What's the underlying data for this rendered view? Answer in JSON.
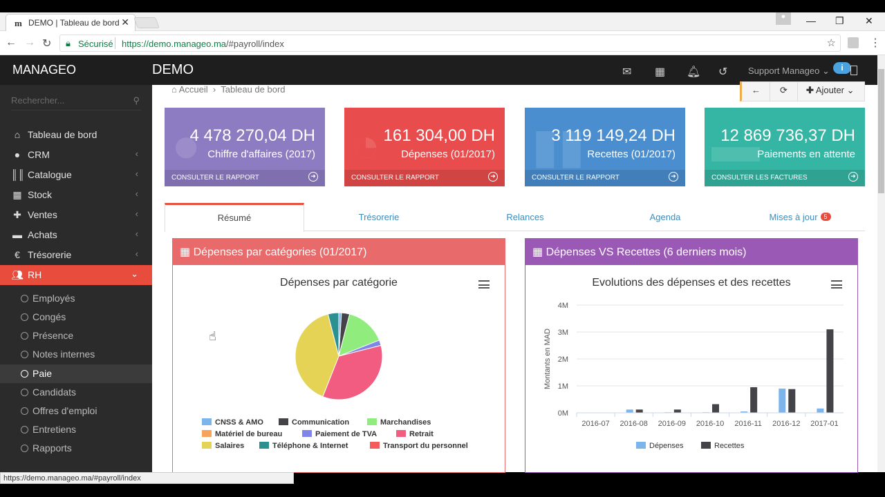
{
  "browser": {
    "tab_title": "DEMO | Tableau de bord",
    "tab_favicon": "m",
    "secure_label": "Sécurisé",
    "url_host": "https://demo.manageo.ma",
    "url_path": "/#payroll/index",
    "status_url": "https://demo.manageo.ma/#payroll/index"
  },
  "sidebar": {
    "brand": "MANAGEO",
    "search_placeholder": "Rechercher...",
    "items": [
      {
        "label": "Tableau de bord",
        "icon": "home-icon"
      },
      {
        "label": "CRM",
        "icon": "globe-icon"
      },
      {
        "label": "Catalogue",
        "icon": "barcode-icon"
      },
      {
        "label": "Stock",
        "icon": "grid-icon"
      },
      {
        "label": "Ventes",
        "icon": "plus-icon"
      },
      {
        "label": "Achats",
        "icon": "minus-icon"
      },
      {
        "label": "Trésorerie",
        "icon": "euro-icon"
      },
      {
        "label": "RH",
        "icon": "users-icon"
      }
    ],
    "rh_sub": [
      "Employés",
      "Congés",
      "Présence",
      "Notes internes",
      "Paie",
      "Candidats",
      "Offres d'emploi",
      "Entretiens",
      "Rapports"
    ]
  },
  "topnav": {
    "title": "DEMO",
    "user": "Support Manageo",
    "info_badge": "i"
  },
  "breadcrumb": {
    "home": "Accueil",
    "current": "Tableau de bord"
  },
  "actions": {
    "back": "←",
    "refresh": "⟳",
    "add": "Ajouter"
  },
  "cards": [
    {
      "value": "4 478 270,04 DH",
      "label": "Chiffre d'affaires (2017)",
      "link": "CONSULTER LE RAPPORT",
      "color": "#8e7cc3"
    },
    {
      "value": "161 304,00 DH",
      "label": "Dépenses (01/2017)",
      "link": "CONSULTER LE RAPPORT",
      "color": "#e84c4c"
    },
    {
      "value": "3 119 149,24 DH",
      "label": "Recettes (01/2017)",
      "link": "CONSULTER LE RAPPORT",
      "color": "#4a8ed0"
    },
    {
      "value": "12 869 736,37 DH",
      "label": "Paiements en attente",
      "link": "CONSULTER LES FACTURES",
      "color": "#35b5a3"
    }
  ],
  "tabs": [
    {
      "label": "Résumé"
    },
    {
      "label": "Trésorerie"
    },
    {
      "label": "Relances"
    },
    {
      "label": "Agenda"
    },
    {
      "label": "Mises à jour",
      "badge": "5"
    }
  ],
  "panel_left": {
    "header": "Dépenses par catégories (01/2017)",
    "color": "#e86a6a"
  },
  "panel_right": {
    "header": "Dépenses VS Recettes (6 derniers mois)",
    "color": "#9b59b6"
  },
  "chart_data": [
    {
      "type": "pie",
      "title": "Dépenses par catégorie",
      "legend_placement": "bottom",
      "slices": [
        {
          "name": "CNSS & AMO",
          "value": 1,
          "color": "#7cb5ec"
        },
        {
          "name": "Communication",
          "value": 3,
          "color": "#434348"
        },
        {
          "name": "Marchandises",
          "value": 15,
          "color": "#90ed7d"
        },
        {
          "name": "Matériel de bureau",
          "value": 0,
          "color": "#f7a35c"
        },
        {
          "name": "Paiement de TVA",
          "value": 2,
          "color": "#8085e9"
        },
        {
          "name": "Retrait",
          "value": 35,
          "color": "#f15c80"
        },
        {
          "name": "Salaires",
          "value": 40,
          "color": "#e4d354"
        },
        {
          "name": "Téléphone & Internet",
          "value": 4,
          "color": "#2b908f"
        },
        {
          "name": "Transport du personnel",
          "value": 0,
          "color": "#f45b5b"
        }
      ]
    },
    {
      "type": "bar",
      "title": "Evolutions des dépenses et des recettes",
      "ylabel": "Montants en MAD",
      "ylim": [
        0,
        4
      ],
      "yticks": [
        "0M",
        "1M",
        "2M",
        "3M",
        "4M"
      ],
      "categories": [
        "2016-07",
        "2016-08",
        "2016-09",
        "2016-10",
        "2016-11",
        "2016-12",
        "2017-01"
      ],
      "legend_placement": "bottom",
      "series": [
        {
          "name": "Dépenses",
          "color": "#7cb5ec",
          "values": [
            0,
            0.12,
            0.02,
            0.02,
            0.05,
            0.9,
            0.16
          ]
        },
        {
          "name": "Recettes",
          "color": "#434348",
          "values": [
            0,
            0.12,
            0.12,
            0.32,
            0.95,
            0.88,
            3.1
          ]
        }
      ]
    }
  ]
}
